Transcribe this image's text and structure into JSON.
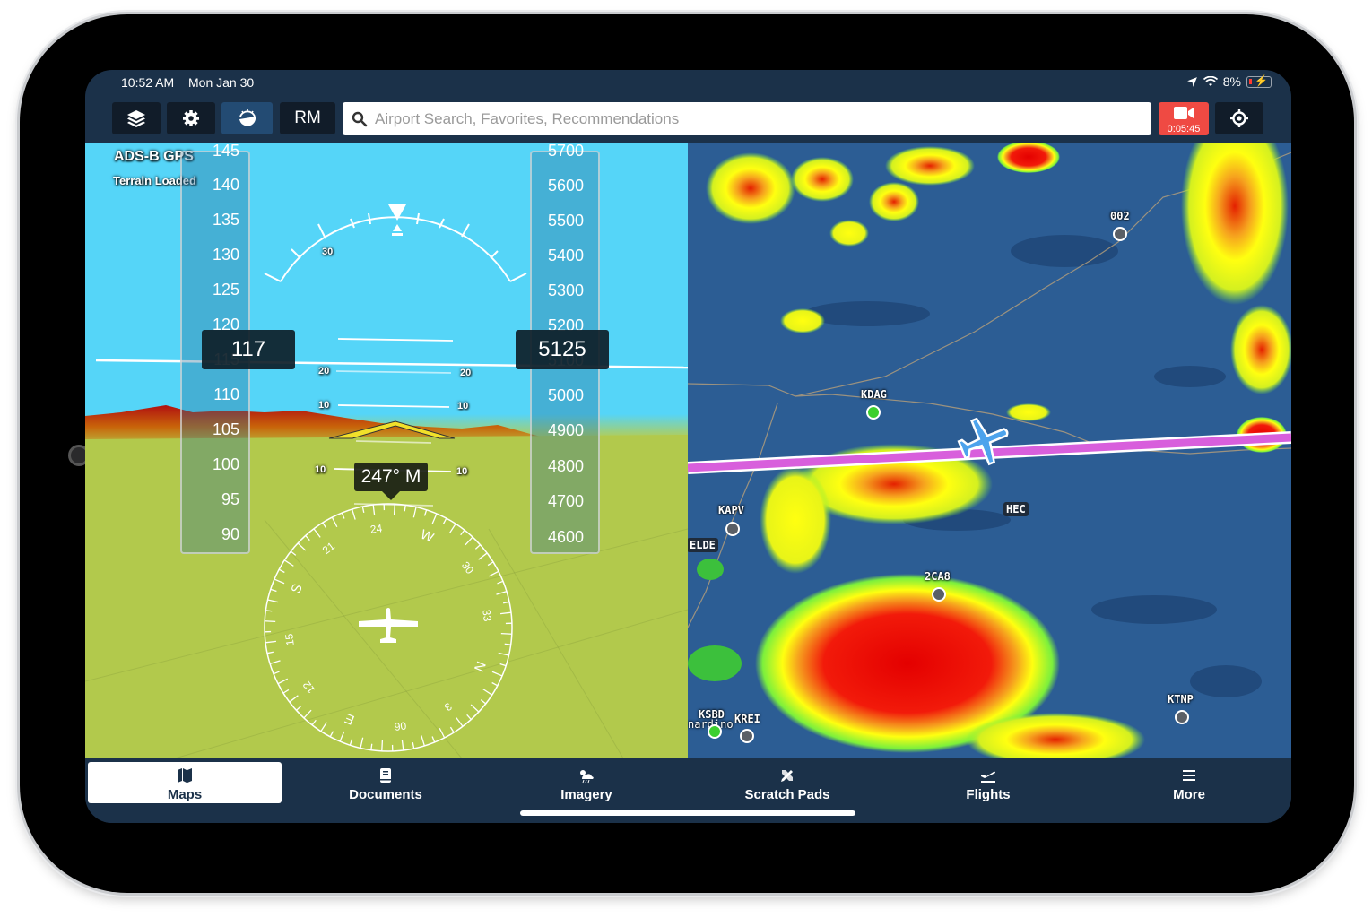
{
  "status_bar": {
    "time": "10:52 AM",
    "date": "Mon Jan 30",
    "battery": "8%",
    "icons": [
      "location-arrow-icon",
      "wifi-icon",
      "battery-charging-icon"
    ]
  },
  "toolbar": {
    "layers_icon": "layers-icon",
    "settings_icon": "gear-icon",
    "synvis_icon": "attitude-indicator-icon",
    "rm_label": "RM",
    "search_placeholder": "Airport Search, Favorites, Recommendations",
    "record_timer": "0:05:45",
    "locate_icon": "crosshair-icon"
  },
  "synthetic_vision": {
    "source_label": "ADS-B GPS",
    "terrain_label": "Terrain Loaded",
    "airspeed": {
      "current": "117",
      "ticks": [
        "145",
        "140",
        "135",
        "130",
        "125",
        "120",
        "115",
        "110",
        "105",
        "100",
        "95",
        "90"
      ]
    },
    "altitude": {
      "current": "5125",
      "ticks": [
        "5700",
        "5600",
        "5500",
        "5400",
        "5300",
        "5200",
        "5100",
        "5000",
        "4900",
        "4800",
        "4700",
        "4600"
      ]
    },
    "pitch_ladder": [
      "30",
      "20",
      "10",
      "10",
      "20"
    ],
    "heading": "247° M",
    "compass_labels": [
      "24",
      "W",
      "30",
      "33",
      "N",
      "3",
      "06",
      "E",
      "12",
      "15",
      "S",
      "21"
    ]
  },
  "map": {
    "airports": [
      {
        "id": "002",
        "color": "#5a5f66"
      },
      {
        "id": "KDAG",
        "color": "#3ccf2e"
      },
      {
        "id": "KAPV",
        "color": "#5a5f66"
      },
      {
        "id": "2CA8",
        "color": "#5a5f66"
      },
      {
        "id": "KTNP",
        "color": "#5a5f66"
      },
      {
        "id": "KSBD",
        "color": "#3ccf2e"
      },
      {
        "id": "KREI",
        "color": "#5a5f66"
      }
    ],
    "city_label": "nardino",
    "waypoints": [
      "ELDE",
      "HEC"
    ],
    "route_color": "#d85fdc"
  },
  "tabs": [
    {
      "label": "Maps",
      "icon": "map-icon",
      "active": true
    },
    {
      "label": "Documents",
      "icon": "book-icon",
      "active": false
    },
    {
      "label": "Imagery",
      "icon": "weather-cloud-icon",
      "active": false
    },
    {
      "label": "Scratch Pads",
      "icon": "pencil-ruler-icon",
      "active": false
    },
    {
      "label": "Flights",
      "icon": "airplane-departure-icon",
      "active": false
    },
    {
      "label": "More",
      "icon": "menu-icon",
      "active": false
    }
  ]
}
